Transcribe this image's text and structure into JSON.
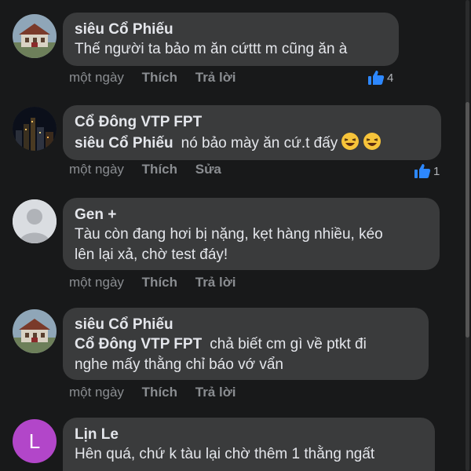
{
  "comments": [
    {
      "author": "siêu Cổ Phiếu",
      "avatar_icon": "house-photo-avatar",
      "text": "Thế người ta bảo m ăn cứttt m cũng ăn à",
      "time": "một ngày",
      "actions": [
        "Thích",
        "Trả lời"
      ],
      "likes": "4"
    },
    {
      "author": "Cổ Đông VTP FPT",
      "avatar_icon": "city-night-photo-avatar",
      "mention": "siêu Cổ Phiếu",
      "text": "nó bảo mày ăn cứ.t đấy",
      "emojis": [
        "laughing-emoji",
        "laughing-emoji"
      ],
      "time": "một ngày",
      "actions": [
        "Thích",
        "Sửa"
      ],
      "likes": "1"
    },
    {
      "author": "Gen +",
      "avatar_icon": "default-user-avatar",
      "text_lines": [
        "Tàu còn đang hơi bị nặng, kẹt hàng nhiều, kéo",
        "lên lại xả, chờ test đáy!"
      ],
      "time": "một ngày",
      "actions": [
        "Thích",
        "Trả lời"
      ]
    },
    {
      "author": "siêu Cổ Phiếu",
      "avatar_icon": "house-photo-avatar",
      "mention": "Cổ Đông VTP FPT",
      "text_line1": "chả biết cm gì về ptkt đi",
      "text_line2": "nghe mấy thằng chỉ báo vớ vẩn",
      "time": "một ngày",
      "actions": [
        "Thích",
        "Trả lời"
      ]
    },
    {
      "author": "Lịn Le",
      "avatar_letter": "L",
      "text_lines": [
        "Hên quá, chứ k tàu lại chờ thêm 1 thằng ngất"
      ]
    }
  ],
  "colors": {
    "background": "#18191a",
    "bubble": "#3a3b3c",
    "meta": "#8a8d91",
    "like_blue": "#2d88ff",
    "letter_avatar": "#b246c9"
  }
}
